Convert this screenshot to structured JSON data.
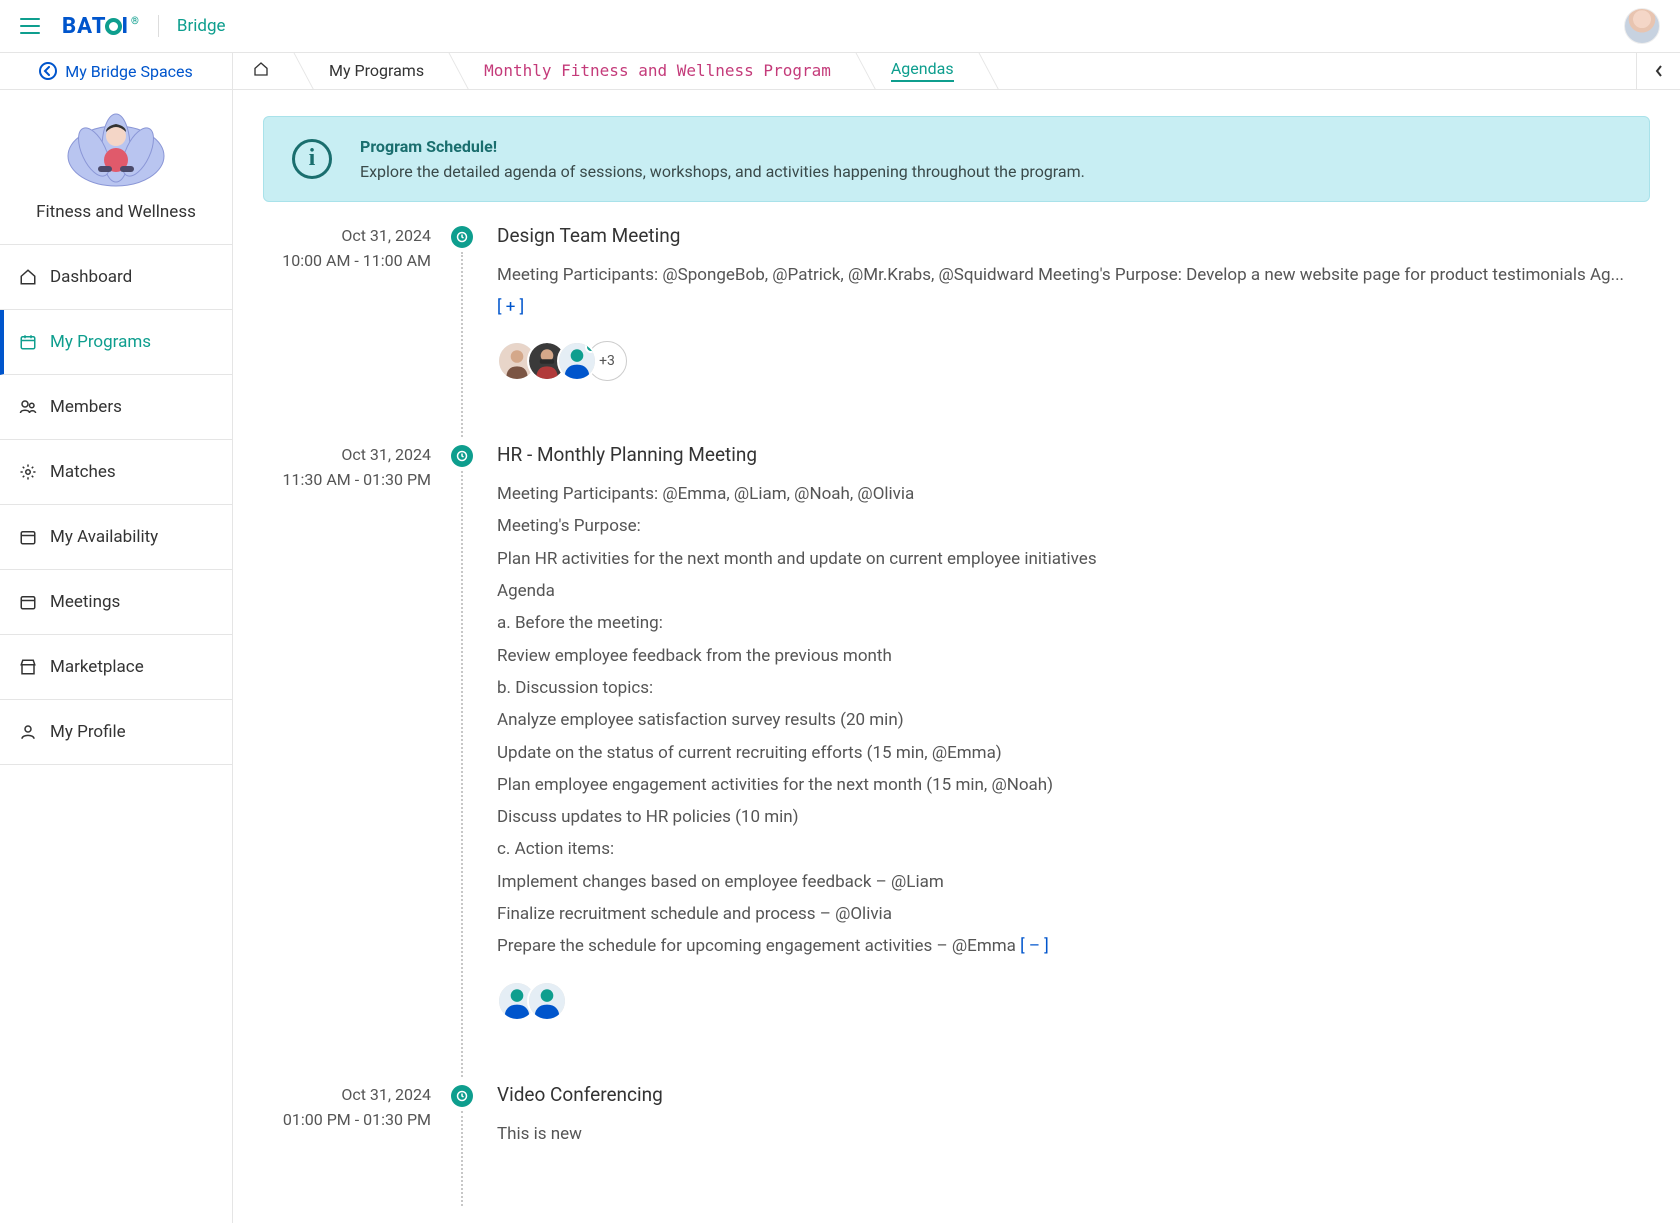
{
  "header": {
    "app_name": "Bridge",
    "logo_text_1": "BAT",
    "logo_text_2": "I",
    "logo_reg": "®"
  },
  "space_bar": {
    "label": "My Bridge Spaces"
  },
  "space_card": {
    "title": "Fitness and Wellness"
  },
  "sidebar": {
    "items": [
      {
        "label": "Dashboard"
      },
      {
        "label": "My Programs"
      },
      {
        "label": "Members"
      },
      {
        "label": "Matches"
      },
      {
        "label": "My Availability"
      },
      {
        "label": "Meetings"
      },
      {
        "label": "Marketplace"
      },
      {
        "label": "My Profile"
      }
    ]
  },
  "breadcrumbs": {
    "programs": "My Programs",
    "program_name": "Monthly Fitness and Wellness Program",
    "current": "Agendas"
  },
  "banner": {
    "title": "Program Schedule!",
    "desc": "Explore the detailed agenda of sessions, workshops, and activities happening throughout the program."
  },
  "agendas": [
    {
      "date": "Oct 31, 2024",
      "time": "10:00 AM - 11:00 AM",
      "title": "Design Team Meeting",
      "summary": "Meeting Participants: @SpongeBob, @Patrick, @Mr.Krabs, @Squidward Meeting's Purpose: Develop a new website page for product testimonials Ag...",
      "expand": "[ + ]",
      "extra_avatars": "+3"
    },
    {
      "date": "Oct 31, 2024",
      "time": "11:30 AM - 01:30 PM",
      "title": "HR - Monthly Planning Meeting",
      "lines": [
        "Meeting Participants: @Emma, @Liam, @Noah, @Olivia",
        "Meeting's Purpose:",
        "Plan HR activities for the next month and update on current employee initiatives",
        "Agenda",
        "a. Before the meeting:",
        "Review employee feedback from the previous month",
        "b. Discussion topics:",
        "Analyze employee satisfaction survey results (20 min)",
        "Update on the status of current recruiting efforts (15 min, @Emma)",
        "Plan employee engagement activities for the next month (15 min, @Noah)",
        "Discuss updates to HR policies (10 min)",
        "c. Action items:",
        "Implement changes based on employee feedback – @Liam",
        "Finalize recruitment schedule and process – @Olivia",
        "Prepare the schedule for upcoming engagement activities – @Emma"
      ],
      "collapse": "[ – ]"
    },
    {
      "date": "Oct 31, 2024",
      "time": "01:00 PM - 01:30 PM",
      "title": "Video Conferencing",
      "summary": "This is new"
    }
  ]
}
